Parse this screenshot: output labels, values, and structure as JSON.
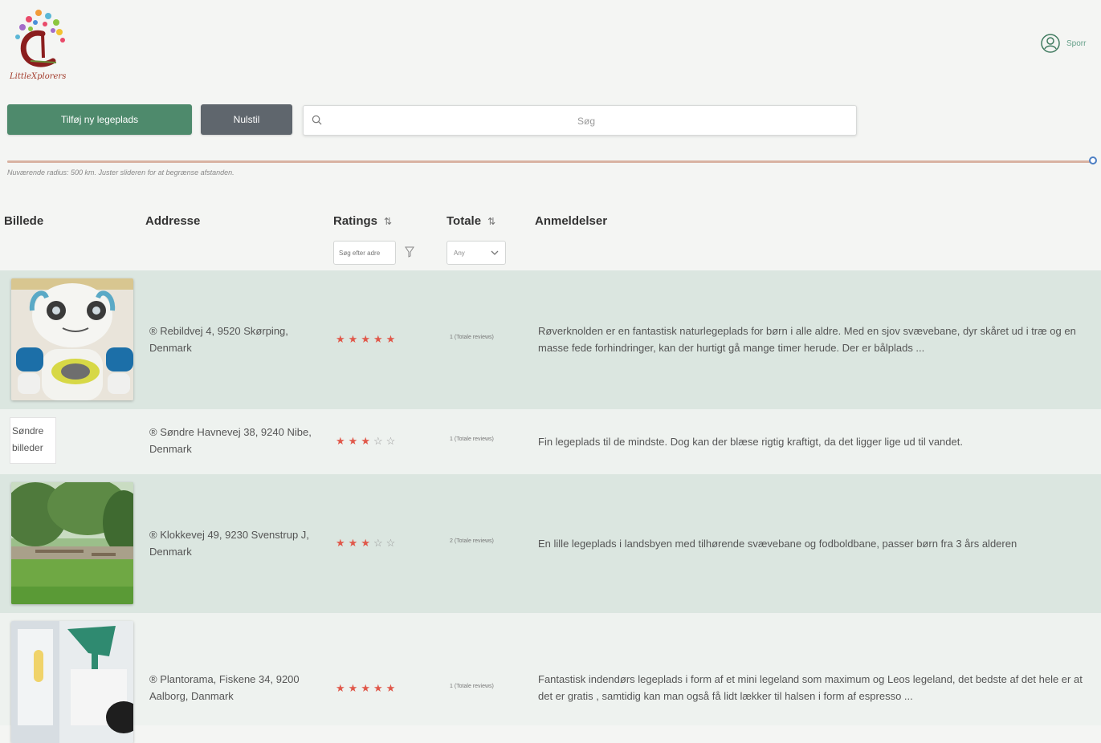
{
  "app": {
    "logo_text": "LittleXplorers"
  },
  "user": {
    "label": "Sporr"
  },
  "toolbar": {
    "add_label": "Tilføj ny legeplads",
    "reset_label": "Nulstil",
    "search_placeholder": "Søg"
  },
  "radius": {
    "note": "Nuværende radius: 500 km. Juster slideren for at begrænse afstanden.",
    "value_fraction": 1.0
  },
  "table": {
    "headers": {
      "image": "Billede",
      "address": "Addresse",
      "ratings": "Ratings",
      "total": "Totale",
      "reviews": "Anmeldelser"
    },
    "rating_filter_placeholder": "Søg efter adre",
    "total_select_value": "Any",
    "rows": [
      {
        "address": "® Rebildvej 4, 9520 Skørping, Denmark",
        "rating": 5,
        "total": "1 (Totale reviews)",
        "review": "Røverknolden er en fantastisk naturlegeplads for børn i alle aldre. Med en sjov svævebane, dyr skåret ud i træ og en masse fede forhindringer, kan der hurtigt gå mange timer herude. Der er bålplads ..."
      },
      {
        "address": "® Søndre Havnevej 38, 9240 Nibe, Denmark",
        "image_alt": "Søndre billeder",
        "rating": 3,
        "total": "1 (Totale reviews)",
        "review": "Fin legeplads til de mindste. Dog kan der blæse rigtig kraftigt, da det ligger lige ud til vandet."
      },
      {
        "address": "® Klokkevej 49, 9230 Svenstrup J, Denmark",
        "rating": 3,
        "total": "2 (Totale reviews)",
        "review": "En lille legeplads i landsbyen med tilhørende svævebane og fodboldbane, passer børn fra 3 års alderen"
      },
      {
        "address": "® Plantorama, Fiskene 34, 9200 Aalborg, Danmark",
        "rating": 5,
        "total": "1 (Totale reviews)",
        "review": "Fantastisk indendørs legeplads i form af et mini legeland som maximum og Leos legeland, det bedste af det hele er at det er gratis , samtidig kan man også få lidt lækker til halsen i form af espresso ..."
      }
    ]
  },
  "colors": {
    "primary_button": "#4e8a6c",
    "secondary_button": "#5f666d",
    "row_dark": "#dbe6e0",
    "row_light": "#eef2ef",
    "star": "#e0584a"
  }
}
